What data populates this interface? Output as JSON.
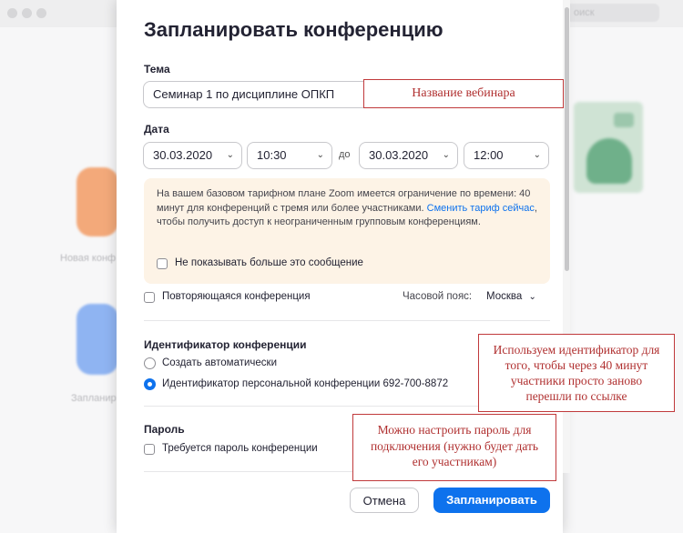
{
  "background": {
    "search_placeholder": "оиск",
    "tile_label_1": "Новая конф",
    "tile_label_2": "Запланир"
  },
  "dialog": {
    "title": "Запланировать конференцию",
    "topic": {
      "label": "Тема",
      "value": "Семинар 1 по дисциплине ОПКП"
    },
    "date": {
      "label": "Дата",
      "start_date": "30.03.2020",
      "start_time": "10:30",
      "to_label": "до",
      "end_date": "30.03.2020",
      "end_time": "12:00"
    },
    "notice": {
      "text_1": "На вашем базовом тарифном плане Zoom имеется ограничение по времени: 40 минут для конференций с тремя или более участниками.",
      "link": "Сменить тариф сейчас",
      "text_2": ", чтобы получить доступ к неограниченным групповым конференциям.",
      "dont_show": "Не показывать больше это сообщение"
    },
    "recurring": "Повторяющаяся конференция",
    "timezone": {
      "label": "Часовой пояс:",
      "value": "Москва"
    },
    "meeting_id": {
      "label": "Идентификатор конференции",
      "option_auto": "Создать автоматически",
      "option_personal": "Идентификатор персональной конференции 692-700-8872",
      "selected": "personal"
    },
    "password": {
      "label": "Пароль",
      "require": "Требуется пароль конференции"
    },
    "cancel_label": "Отмена",
    "schedule_label": "Запланировать"
  },
  "annotations": {
    "topic_note": "Название вебинара",
    "id_note": "Используем идентификатор для того, чтобы через 40 минут участники просто заново перешли по ссылке",
    "password_note": "Можно настроить пароль для подключения (нужно будет дать его участникам)"
  },
  "colors": {
    "accent": "#0e72ed",
    "notice_bg": "#fdf3e6",
    "annotation_border": "#c0393b"
  }
}
